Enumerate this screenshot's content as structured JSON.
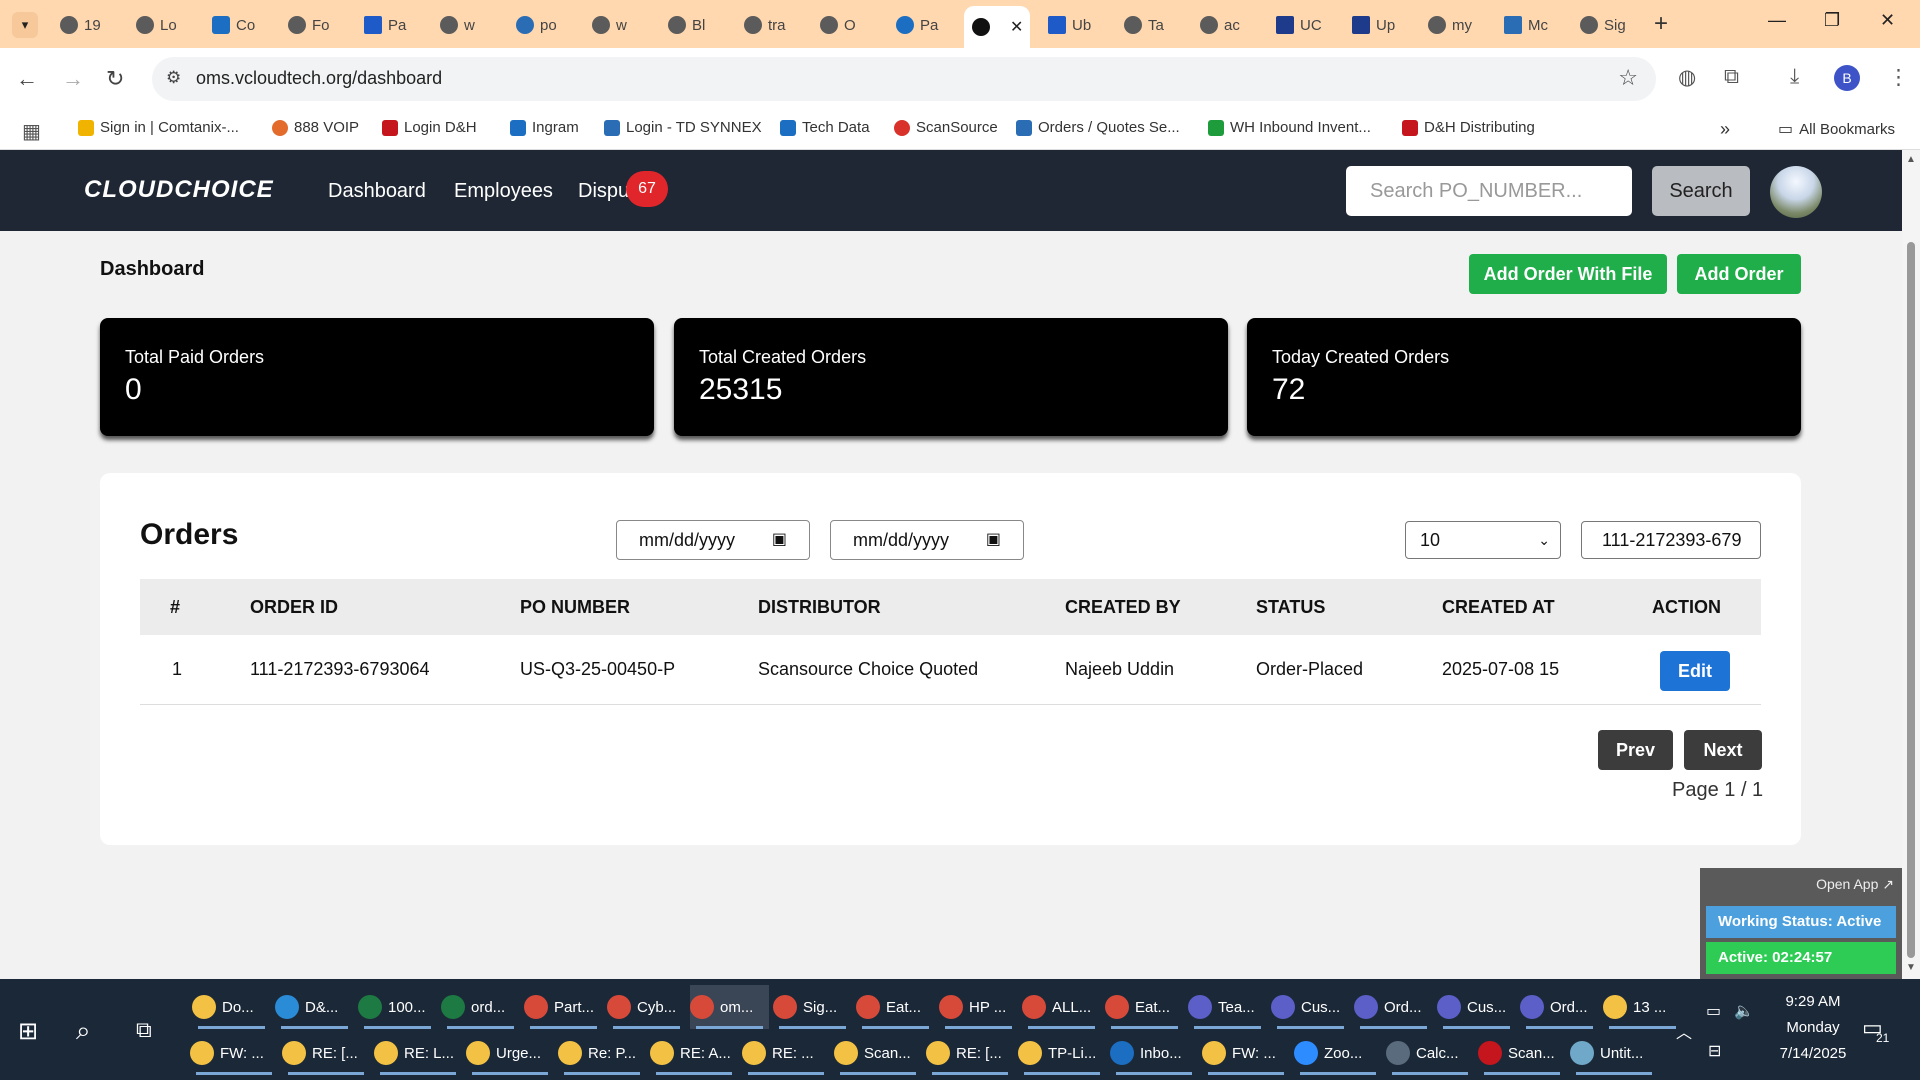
{
  "browser": {
    "tabs": [
      {
        "label": "19"
      },
      {
        "label": "Lo"
      },
      {
        "label": "Co"
      },
      {
        "label": "Fo"
      },
      {
        "label": "Pa"
      },
      {
        "label": "w"
      },
      {
        "label": "po"
      },
      {
        "label": "w"
      },
      {
        "label": "Bl"
      },
      {
        "label": "tra"
      },
      {
        "label": "O"
      },
      {
        "label": "Pa"
      },
      {
        "label": ""
      },
      {
        "label": "Ub"
      },
      {
        "label": "Ta"
      },
      {
        "label": "ac"
      },
      {
        "label": "UC"
      },
      {
        "label": "Up"
      },
      {
        "label": "my"
      },
      {
        "label": "Mc"
      },
      {
        "label": "Sig"
      }
    ],
    "url": "oms.vcloudtech.org/dashboard",
    "profile_initial": "B",
    "bookmarks": [
      {
        "label": "Sign in | Comtanix-...",
        "color": "#f0b400"
      },
      {
        "label": "888 VOIP",
        "color": "#e36b2c"
      },
      {
        "label": "Login D&H",
        "color": "#c4161c"
      },
      {
        "label": "Ingram",
        "color": "#1b6ec2"
      },
      {
        "label": "Login - TD SYNNEX",
        "color": "#2a6db5"
      },
      {
        "label": "Tech Data",
        "color": "#1b6ec2"
      },
      {
        "label": "ScanSource",
        "color": "#d9322b"
      },
      {
        "label": "Orders / Quotes Se...",
        "color": "#2a6db5"
      },
      {
        "label": "WH Inbound Invent...",
        "color": "#1e9b3a"
      },
      {
        "label": "D&H Distributing",
        "color": "#c4161c"
      }
    ],
    "all_bookmarks": "All Bookmarks"
  },
  "navbar": {
    "logo": "CLOUDCHOICE",
    "links": [
      "Dashboard",
      "Employees",
      "Dispu"
    ],
    "badge": "67",
    "search_placeholder": "Search PO_NUMBER...",
    "search_label": "Search"
  },
  "dashboard": {
    "title": "Dashboard",
    "add_with_file": "Add Order With File",
    "add_order": "Add Order",
    "stats": [
      {
        "label": "Total Paid Orders",
        "value": "0"
      },
      {
        "label": "Total Created Orders",
        "value": "25315"
      },
      {
        "label": "Today Created Orders",
        "value": "72"
      }
    ]
  },
  "orders": {
    "title": "Orders",
    "date_from": "mm/dd/yyyy",
    "date_to": "mm/dd/yyyy",
    "page_size": "10",
    "filter_value": "111-2172393-679",
    "columns": [
      "#",
      "ORDER ID",
      "PO NUMBER",
      "DISTRIBUTOR",
      "CREATED BY",
      "STATUS",
      "CREATED AT",
      "ACTION"
    ],
    "rows": [
      {
        "num": "1",
        "order_id": "111-2172393-6793064",
        "po_number": "US-Q3-25-00450-P",
        "distributor": "Scansource Choice Quoted",
        "created_by": "Najeeb Uddin",
        "status": "Order-Placed",
        "created_at": "2025-07-08 15",
        "action": "Edit"
      }
    ],
    "prev": "Prev",
    "next": "Next",
    "page_info": "Page 1 / 1"
  },
  "widget": {
    "open_app": "Open App ↗",
    "working_status": "Working Status: Active",
    "active_time": "Active: 02:24:57"
  },
  "taskbar": {
    "row1": [
      {
        "label": "Do...",
        "color": "#f3c244"
      },
      {
        "label": "D&...",
        "color": "#2a8bd6"
      },
      {
        "label": "100...",
        "color": "#1d7a43"
      },
      {
        "label": "ord...",
        "color": "#1d7a43"
      },
      {
        "label": "Part...",
        "color": "#d74a3a"
      },
      {
        "label": "Cyb...",
        "color": "#d74a3a"
      },
      {
        "label": "om...",
        "color": "#d74a3a"
      },
      {
        "label": "Sig...",
        "color": "#d74a3a"
      },
      {
        "label": "Eat...",
        "color": "#d74a3a"
      },
      {
        "label": "HP ...",
        "color": "#d74a3a"
      },
      {
        "label": "ALL...",
        "color": "#d74a3a"
      },
      {
        "label": "Eat...",
        "color": "#d74a3a"
      },
      {
        "label": "Tea...",
        "color": "#5b5fc7"
      },
      {
        "label": "Cus...",
        "color": "#5b5fc7"
      },
      {
        "label": "Ord...",
        "color": "#5b5fc7"
      },
      {
        "label": "Cus...",
        "color": "#5b5fc7"
      },
      {
        "label": "Ord...",
        "color": "#5b5fc7"
      },
      {
        "label": "13 ...",
        "color": "#f3c244"
      }
    ],
    "row2": [
      {
        "label": "FW: ...",
        "color": "#f3c244"
      },
      {
        "label": "RE: [...",
        "color": "#f3c244"
      },
      {
        "label": "RE: L...",
        "color": "#f3c244"
      },
      {
        "label": "Urge...",
        "color": "#f3c244"
      },
      {
        "label": "Re: P...",
        "color": "#f3c244"
      },
      {
        "label": "RE: A...",
        "color": "#f3c244"
      },
      {
        "label": "RE: ...",
        "color": "#f3c244"
      },
      {
        "label": "Scan...",
        "color": "#f3c244"
      },
      {
        "label": "RE: [...",
        "color": "#f3c244"
      },
      {
        "label": "TP-Li...",
        "color": "#f3c244"
      },
      {
        "label": "Inbo...",
        "color": "#1b6ec2"
      },
      {
        "label": "FW: ...",
        "color": "#f3c244"
      },
      {
        "label": "Zoo...",
        "color": "#2d8cff"
      },
      {
        "label": "Calc...",
        "color": "#5a6b7d"
      },
      {
        "label": "Scan...",
        "color": "#c4161c"
      },
      {
        "label": "Untit...",
        "color": "#6fa8c8"
      }
    ],
    "time": "9:29 AM",
    "day": "Monday",
    "date": "7/14/2025",
    "notifications": "21"
  }
}
